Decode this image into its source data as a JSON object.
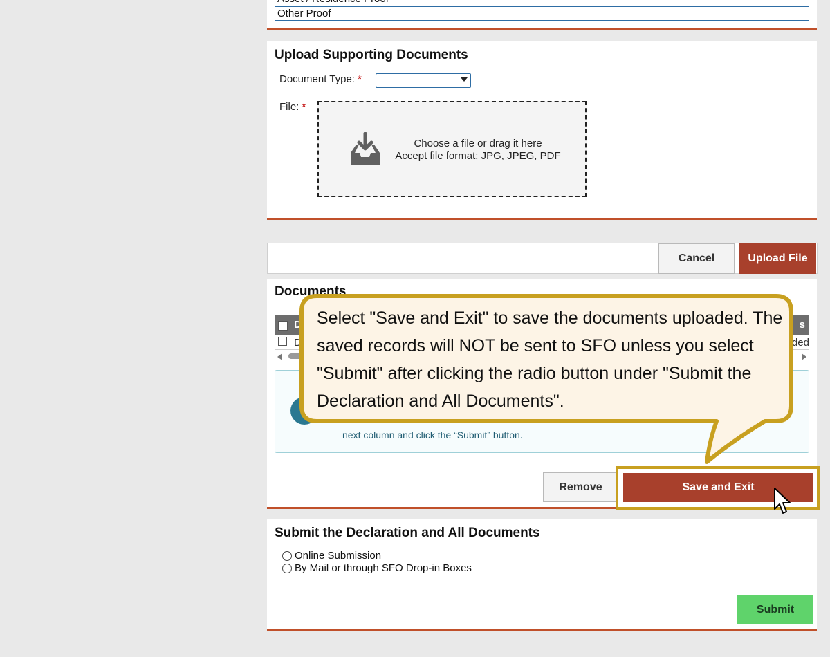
{
  "proof_list": {
    "items": [
      "Asset / Residence Proof",
      "Other Proof"
    ]
  },
  "upload": {
    "title": "Upload Supporting Documents",
    "doc_type_label": "Document Type:",
    "required_mark": "*",
    "doc_type_value": "",
    "file_label": "File:",
    "drop_line1": "Choose a file or drag it here",
    "drop_line2": "Accept file format: JPG, JPEG, PDF",
    "drop_icon": "inbox-download-icon"
  },
  "upload_actions": {
    "cancel_label": "Cancel",
    "upload_label": "Upload File"
  },
  "documents": {
    "title": "Documents",
    "header_first_col": "D",
    "header_last_col": "s",
    "row_first_col": "D",
    "row_last_col": "aded",
    "info_text": "next column and click the “Submit” button.",
    "remove_label": "Remove",
    "save_exit_label": "Save and Exit"
  },
  "callout": {
    "text": "Select \"Save and Exit\" to save the documents uploaded. The saved records will NOT be sent to SFO unless you select \"Submit\" after clicking the radio button under \"Submit the Declaration and All Documents\"."
  },
  "submit_section": {
    "title": "Submit the Declaration and All Documents",
    "options": [
      "Online Submission",
      "By Mail or through SFO Drop-in Boxes"
    ],
    "submit_label": "Submit"
  },
  "colors": {
    "accent_red": "#a8402c",
    "rule_orange": "#c0502a",
    "callout_border": "#c8a020",
    "submit_green": "#5fd36b"
  }
}
